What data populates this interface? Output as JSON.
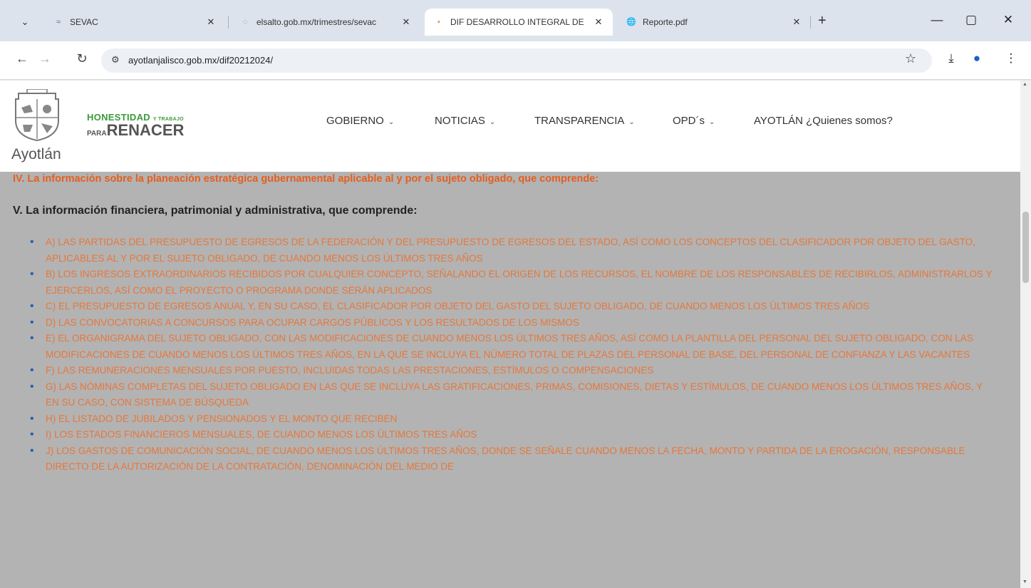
{
  "browser": {
    "tabs": [
      {
        "title": "SEVAC",
        "favicon": "sevac-icon"
      },
      {
        "title": "elsalto.gob.mx/trimestres/sevac",
        "favicon": "globe-icon"
      },
      {
        "title": "DIF DESARROLLO INTEGRAL DE",
        "favicon": "site-icon"
      },
      {
        "title": "Reporte.pdf",
        "favicon": "globe-icon"
      }
    ],
    "active_tab_index": 2,
    "url": "ayotlanjalisco.gob.mx/dif20212024/"
  },
  "site": {
    "logo_text": "Ayotlán",
    "slogan_top": "HONESTIDAD",
    "slogan_top_small": "Y TRABAJO",
    "slogan_para": "PARA",
    "slogan_bottom": "RENACER",
    "menu": [
      "GOBIERNO",
      "NOTICIAS",
      "TRANSPARENCIA",
      "OPD´s",
      "AYOTLÁN ¿Quienes somos?"
    ]
  },
  "content": {
    "heading_iv": "IV. La información sobre la planeación estratégica gubernamental aplicable al y por el sujeto obligado, que comprende:",
    "heading_v": "V. La información financiera, patrimonial y administrativa, que comprende:",
    "items": [
      "A) LAS PARTIDAS DEL PRESUPUESTO DE EGRESOS DE LA FEDERACIÓN Y DEL PRESUPUESTO DE EGRESOS DEL ESTADO, ASÍ COMO LOS CONCEPTOS DEL CLASIFICADOR POR OBJETO DEL GASTO, APLICABLES AL Y POR EL SUJETO OBLIGADO, DE CUANDO MENOS LOS ÚLTIMOS TRES AÑOS",
      "B) LOS INGRESOS EXTRAORDINARIOS RECIBIDOS POR CUALQUIER CONCEPTO, SEÑALANDO EL ORIGEN DE LOS RECURSOS, EL NOMBRE DE LOS RESPONSABLES DE RECIBIRLOS, ADMINISTRARLOS Y EJERCERLOS, ASÍ COMO EL PROYECTO O PROGRAMA DONDE SERÁN APLICADOS",
      "C) EL PRESUPUESTO DE EGRESOS ANUAL Y, EN SU CASO, EL CLASIFICADOR POR OBJETO DEL GASTO DEL SUJETO OBLIGADO, DE CUANDO MENOS LOS ÚLTIMOS TRES AÑOS",
      "D) LAS CONVOCATORIAS A CONCURSOS PARA OCUPAR CARGOS PÚBLICOS Y LOS RESULTADOS DE LOS MISMOS",
      "E) EL ORGANIGRAMA DEL SUJETO OBLIGADO, CON LAS MODIFICACIONES DE CUANDO MENOS LOS ÚLTIMOS TRES AÑOS, ASÍ COMO LA PLANTILLA DEL PERSONAL DEL SUJETO OBLIGADO, CON LAS MODIFICACIONES DE CUANDO MENOS LOS ÚLTIMOS TRES AÑOS, EN LA QUE SE INCLUYA EL NÚMERO TOTAL DE PLAZAS DEL PERSONAL DE BASE, DEL PERSONAL DE CONFIANZA Y LAS VACANTES",
      "F) LAS REMUNERACIONES MENSUALES POR PUESTO, INCLUIDAS TODAS LAS PRESTACIONES, ESTÍMULOS O COMPENSACIONES",
      "G) LAS NÓMINAS COMPLETAS DEL SUJETO OBLIGADO EN LAS QUE SE INCLUYA LAS GRATIFICACIONES, PRIMAS, COMISIONES, DIETAS Y ESTÍMULOS, DE CUANDO MENOS LOS ÚLTIMOS TRES AÑOS, Y EN SU CASO, CON SISTEMA DE BÚSQUEDA",
      "H) EL LISTADO DE JUBILADOS Y PENSIONADOS Y EL MONTO QUE RECIBEN",
      "I) LOS ESTADOS FINANCIEROS MENSUALES, DE CUANDO MENOS LOS ÚLTIMOS TRES AÑOS",
      "J) LOS GASTOS DE COMUNICACIÓN SOCIAL, DE CUANDO MENOS LOS ÚLTIMOS TRES AÑOS, DONDE SE SEÑALE CUANDO MENOS LA FECHA, MONTO Y PARTIDA DE LA EROGACIÓN, RESPONSABLE DIRECTO DE LA AUTORIZACIÓN DE LA CONTRATACIÓN, DENOMINACIÓN DEL MEDIO DE"
    ]
  },
  "colors": {
    "accent_orange": "#e55f1f",
    "item_orange": "#e6773a",
    "overlay_gray": "#b3b3b3",
    "brand_green": "#3a9b3a"
  }
}
